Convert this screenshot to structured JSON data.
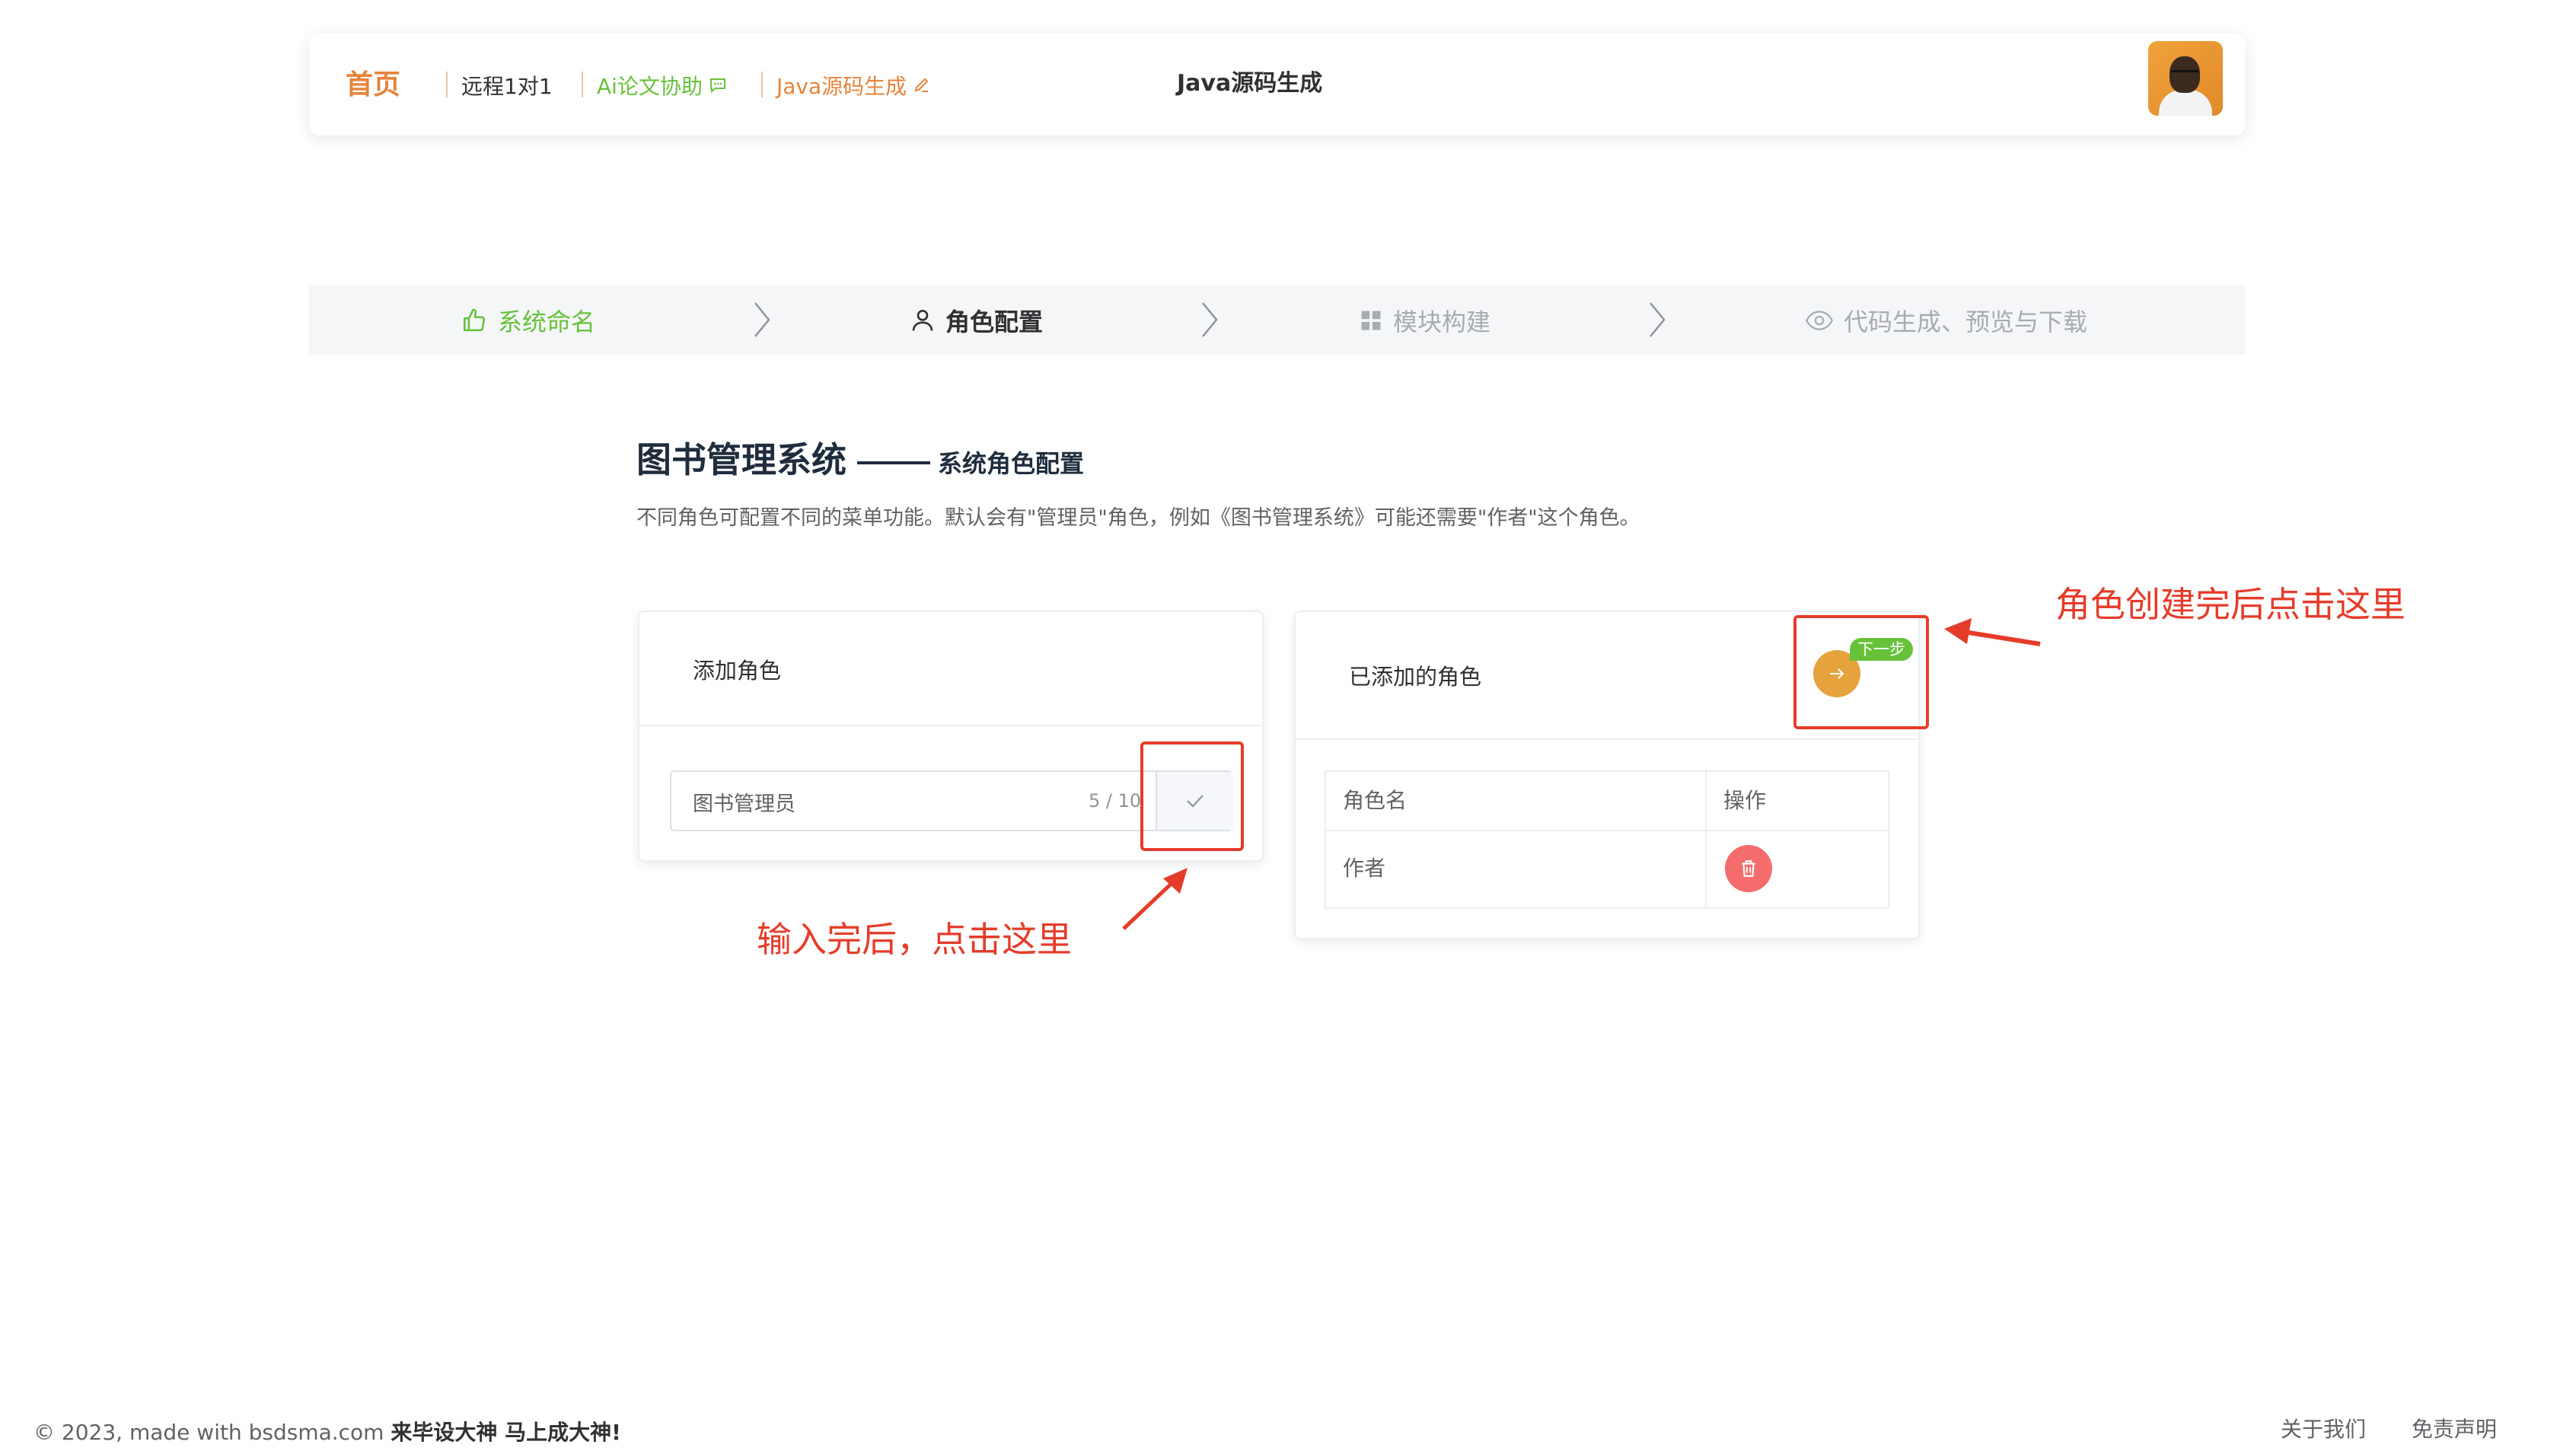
{
  "header": {
    "home": "首页",
    "nav": [
      {
        "label": "远程1对1"
      },
      {
        "label": "Ai论文协助"
      },
      {
        "label": "Java源码生成"
      }
    ],
    "title": "Java源码生成"
  },
  "steps": [
    {
      "label": "系统命名",
      "state": "done"
    },
    {
      "label": "角色配置",
      "state": "active"
    },
    {
      "label": "模块构建",
      "state": "pending"
    },
    {
      "label": "代码生成、预览与下载",
      "state": "pending"
    }
  ],
  "page": {
    "title": "图书管理系统",
    "subtitle": "系统角色配置",
    "description": "不同角色可配置不同的菜单功能。默认会有\"管理员\"角色，例如《图书管理系统》可能还需要\"作者\"这个角色。"
  },
  "add_role": {
    "title": "添加角色",
    "input_value": "图书管理员",
    "count": "5 / 10"
  },
  "role_list": {
    "title": "已添加的角色",
    "next_label": "下一步",
    "columns": [
      "角色名",
      "操作"
    ],
    "rows": [
      {
        "name": "作者"
      }
    ]
  },
  "annotations": {
    "input_hint": "输入完后，点击这里",
    "next_hint": "角色创建完后点击这里"
  },
  "footer": {
    "copyright": "© 2023, made with bsdsma.com",
    "slogan": "来毕设大神 马上成大神!",
    "links": [
      "关于我们",
      "免责声明"
    ]
  },
  "colors": {
    "brand_orange": "#e6843c",
    "success_green": "#67c23a",
    "danger_red": "#f56c6c",
    "warning_orange": "#e6a23c",
    "annotation_red": "#e53c2a"
  }
}
